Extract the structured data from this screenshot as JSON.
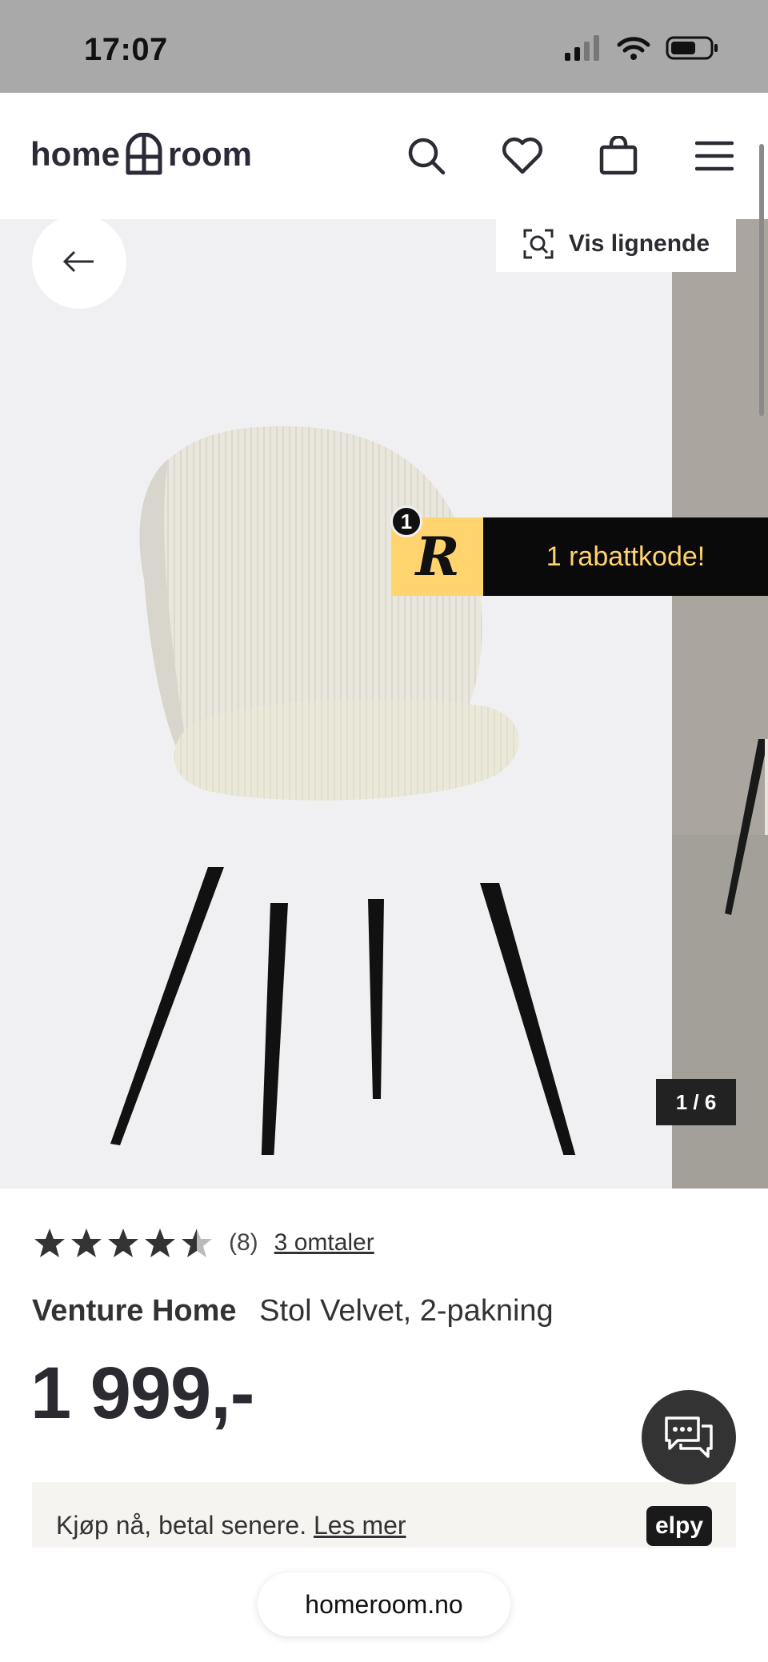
{
  "status_bar": {
    "time": "17:07"
  },
  "header": {
    "logo_left": "home",
    "logo_right": "room",
    "icons": [
      "search-icon",
      "heart-icon",
      "bag-icon",
      "menu-icon"
    ]
  },
  "gallery": {
    "similar_label": "Vis lignende",
    "promo_text": "1 rabattkode!",
    "promo_badge": "1",
    "promo_logo": "R",
    "pager": "1 / 6"
  },
  "product": {
    "rating": 4.5,
    "rating_max": 5,
    "review_count": "(8)",
    "reviews_link": "3 omtaler",
    "brand": "Venture Home",
    "name": "Stol Velvet, 2-pakning",
    "price": "1 999,-"
  },
  "paylater": {
    "text": "Kjøp nå, betal senere.",
    "link": "Les mer",
    "brand": "elpy"
  },
  "browser": {
    "url": "homeroom.no"
  },
  "colors": {
    "accent": "#ffd36e",
    "dark": "#2b2b33"
  }
}
